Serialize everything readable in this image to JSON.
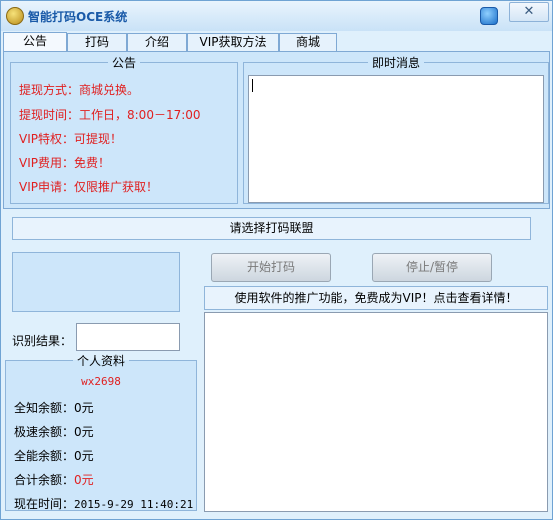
{
  "window": {
    "title": "智能打码OCE系统",
    "close_label": "✕"
  },
  "tabs": [
    {
      "label": "公告",
      "active": true
    },
    {
      "label": "打码",
      "active": false
    },
    {
      "label": "介绍",
      "active": false
    },
    {
      "label": "VIP获取方法",
      "active": false
    },
    {
      "label": "商城",
      "active": false
    }
  ],
  "notice": {
    "title": "公告",
    "lines": [
      "提现方式：商城兑换。",
      "提现时间：工作日，8:00－17:00",
      "VIP特权：可提现！",
      "VIP费用：免费！",
      "VIP申请：仅限推广获取！"
    ]
  },
  "messages": {
    "title": "即时消息",
    "text": ""
  },
  "alliance_bar": {
    "text": "请选择打码联盟"
  },
  "buttons": {
    "start": "开始打码",
    "stop": "停止/暂停"
  },
  "promo": {
    "text": "使用软件的推广功能，免费成为VIP！点击查看详情！"
  },
  "result": {
    "label": "识别结果：",
    "value": ""
  },
  "profile": {
    "title": "个人资料",
    "username": "wx2698",
    "rows": [
      {
        "label": "全知余额：",
        "value": "0元",
        "highlight": false
      },
      {
        "label": "极速余额：",
        "value": "0元",
        "highlight": false
      },
      {
        "label": "全能余额：",
        "value": "0元",
        "highlight": false
      },
      {
        "label": "合计余额：",
        "value": "0元",
        "highlight": true
      },
      {
        "label": "现在时间：",
        "value": "2015-9-29  11:40:21",
        "highlight": false
      }
    ]
  },
  "colors": {
    "accent": "#1a5aa8",
    "notice_red": "#e02020",
    "panel_bg": "#cde6fa"
  }
}
